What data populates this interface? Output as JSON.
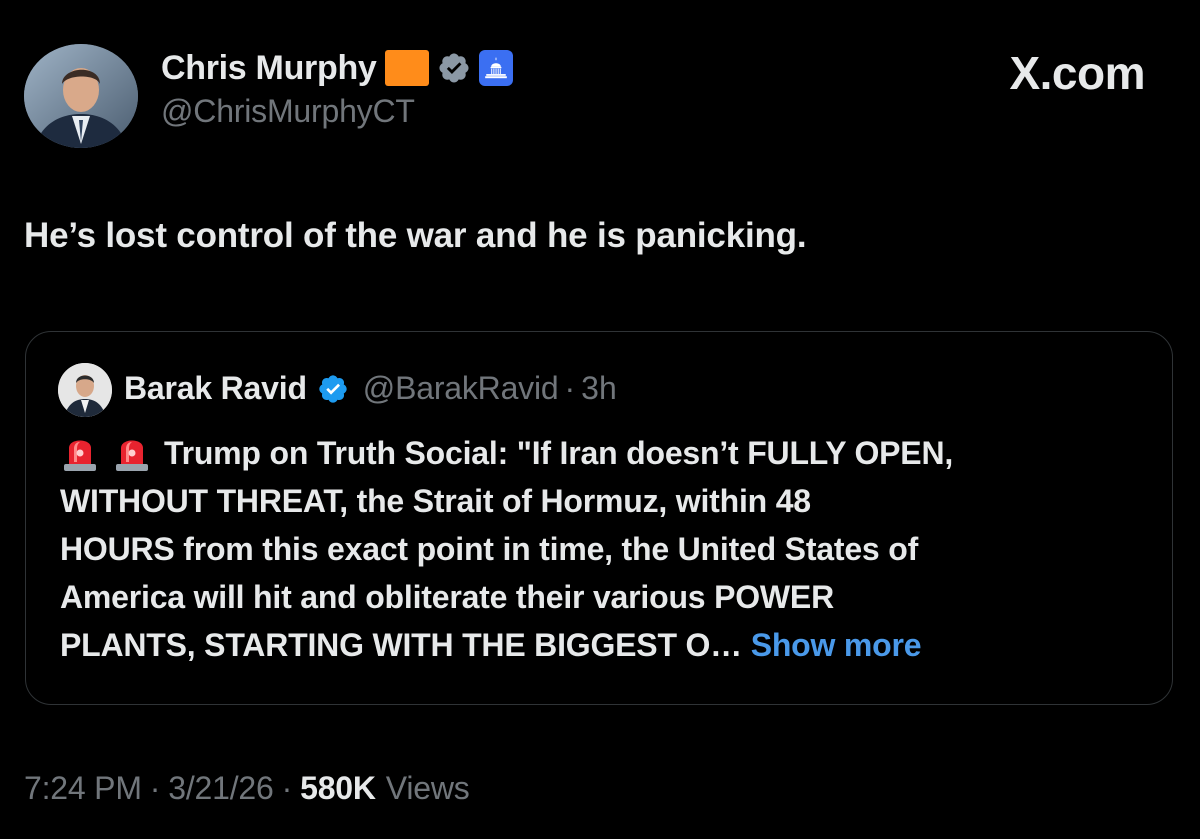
{
  "author": {
    "display_name": "Chris Murphy",
    "handle": "@ChrisMurphyCT",
    "avatar_icon": "avatar-portrait",
    "flag_color": "#ff8c1a",
    "verified_icon": "verified-badge-icon",
    "affiliation_icon": "capitol-icon"
  },
  "brand": {
    "label": "X.com"
  },
  "tweet": {
    "text": "He’s lost control of the war and he is panicking."
  },
  "quoted_tweet": {
    "display_name": "Barak Ravid",
    "handle": "@BarakRavid",
    "separator": "·",
    "time": "3h",
    "prefix_icons": [
      "siren-emoji",
      "siren-emoji"
    ],
    "lines": [
      "Trump on Truth Social: \"If Iran doesn’t FULLY OPEN,",
      "WITHOUT THREAT, the Strait of Hormuz, within 48",
      "HOURS from this exact point in time, the United States of",
      "America will hit and obliterate their various POWER",
      "PLANTS, STARTING WITH THE BIGGEST O…"
    ],
    "show_more_label": "Show more"
  },
  "meta": {
    "time": "7:24 PM",
    "separator": "·",
    "date": "3/21/26",
    "views_count": "580K",
    "views_label": "Views"
  },
  "colors": {
    "background": "#000000",
    "primary_text": "#e7e9ea",
    "secondary_text": "#71767b",
    "link": "#4a99e9",
    "border": "#2f3336",
    "verified_blue": "#1d9bf0",
    "verified_gray": "#8b98a5",
    "capitol_blue": "#3b6ff2"
  }
}
